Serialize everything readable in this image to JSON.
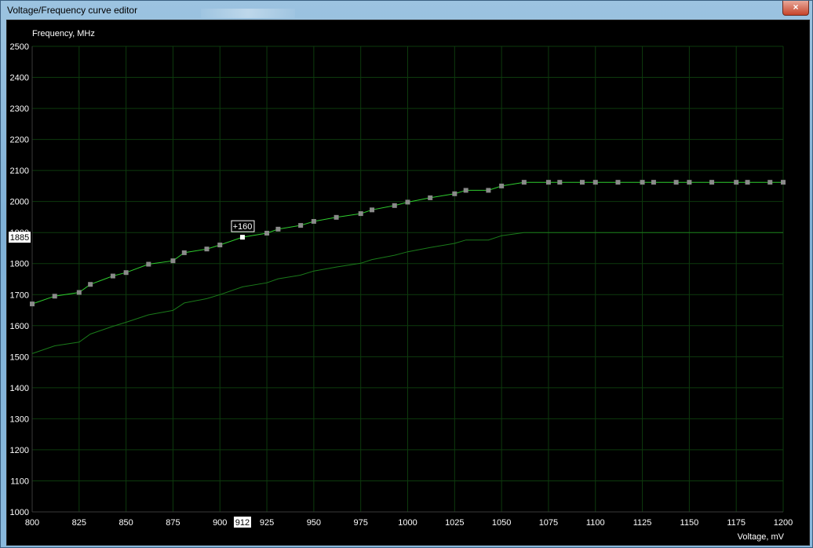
{
  "window": {
    "title": "Voltage/Frequency curve editor",
    "close_label": "×"
  },
  "colors": {
    "background": "#000000",
    "grid": "#0d3a0d",
    "curve": "#2ecc2e",
    "base_curve": "#1a7a1a",
    "marker": "#8a8a8a",
    "axis_text": "#ffffff"
  },
  "chart_data": {
    "type": "line",
    "ylabel": "Frequency, MHz",
    "xlabel": "Voltage, mV",
    "xlim": [
      800,
      1200
    ],
    "ylim": [
      1000,
      2500
    ],
    "x_ticks": [
      800,
      825,
      850,
      875,
      900,
      925,
      950,
      975,
      1000,
      1025,
      1050,
      1075,
      1100,
      1125,
      1150,
      1175,
      1200
    ],
    "y_ticks": [
      1000,
      1100,
      1200,
      1300,
      1400,
      1500,
      1600,
      1700,
      1800,
      1900,
      2000,
      2100,
      2200,
      2300,
      2400,
      2500
    ],
    "grid": true,
    "series": [
      {
        "role": "curve",
        "x": [
          800,
          812,
          825,
          831,
          843,
          850,
          862,
          875,
          881,
          893,
          900,
          912,
          925,
          931,
          943,
          950,
          962,
          975,
          981,
          993,
          1000,
          1012,
          1025,
          1031,
          1043,
          1050,
          1062,
          1075,
          1081,
          1093,
          1100,
          1112,
          1125,
          1131,
          1143,
          1150,
          1162,
          1175,
          1181,
          1193,
          1200
        ],
        "y": [
          1670,
          1695,
          1707,
          1733,
          1760,
          1771,
          1798,
          1809,
          1835,
          1847,
          1860,
          1885,
          1898,
          1911,
          1923,
          1936,
          1949,
          1961,
          1973,
          1987,
          1998,
          2012,
          2025,
          2036,
          2036,
          2050,
          2062,
          2062,
          2062,
          2062,
          2062,
          2062,
          2062,
          2062,
          2062,
          2062,
          2062,
          2062,
          2062,
          2062,
          2062
        ],
        "markers": true
      },
      {
        "role": "base",
        "x": [
          800,
          812,
          825,
          831,
          843,
          850,
          862,
          875,
          881,
          893,
          900,
          912,
          925,
          931,
          943,
          950,
          962,
          975,
          981,
          993,
          1000,
          1012,
          1025,
          1031,
          1043,
          1050,
          1062,
          1075,
          1200
        ],
        "y": [
          1510,
          1535,
          1547,
          1573,
          1598,
          1611,
          1635,
          1649,
          1673,
          1687,
          1700,
          1725,
          1738,
          1751,
          1763,
          1776,
          1789,
          1801,
          1813,
          1827,
          1838,
          1852,
          1865,
          1876,
          1876,
          1890,
          1900,
          1900,
          1900
        ],
        "markers": false
      }
    ],
    "selected": {
      "x": 912,
      "y": 1885,
      "x_label": "912",
      "y_label": "1885",
      "offset_label": "+160"
    }
  }
}
